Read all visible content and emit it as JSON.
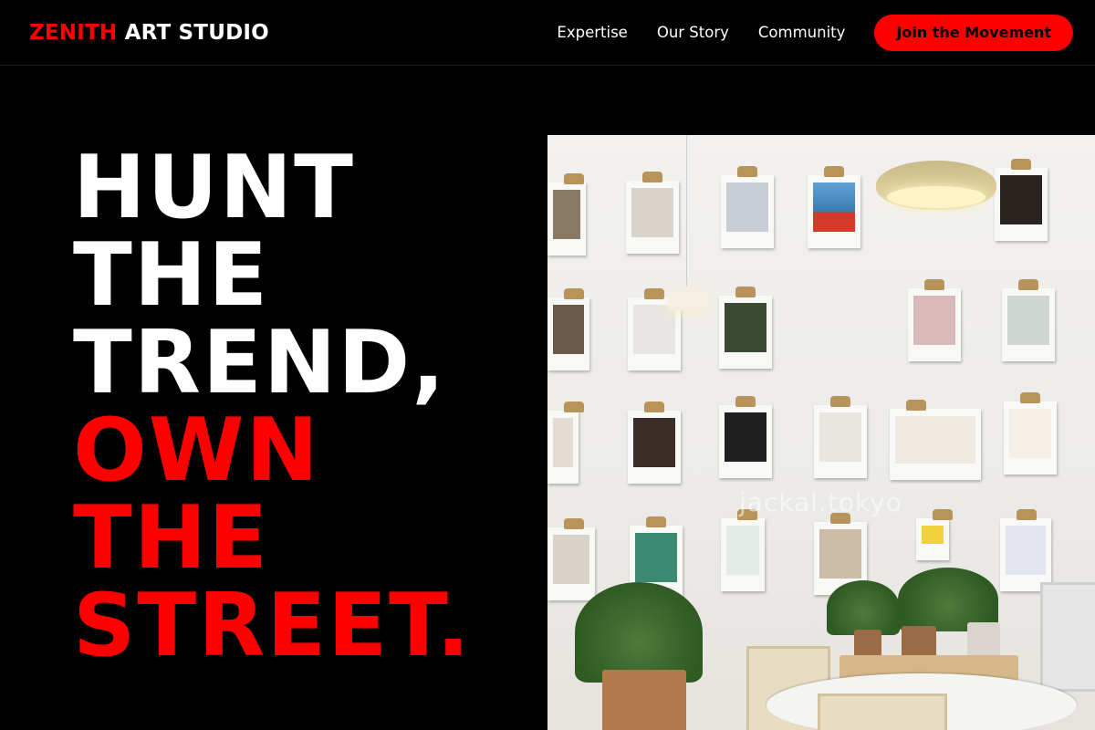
{
  "header": {
    "brand_accent": "ZENITH",
    "brand_rest": "ART STUDIO",
    "nav": [
      "Expertise",
      "Our Story",
      "Community"
    ],
    "cta_label": "Join the Movement"
  },
  "hero": {
    "lines_white": [
      "HUNT",
      "THE",
      "TREND,"
    ],
    "lines_red": [
      "OWN",
      "THE",
      "STREET."
    ]
  },
  "photo": {
    "watermark": "jackal.tokyo"
  },
  "colors": {
    "accent": "#ff0000",
    "background": "#000000",
    "text": "#ffffff"
  }
}
